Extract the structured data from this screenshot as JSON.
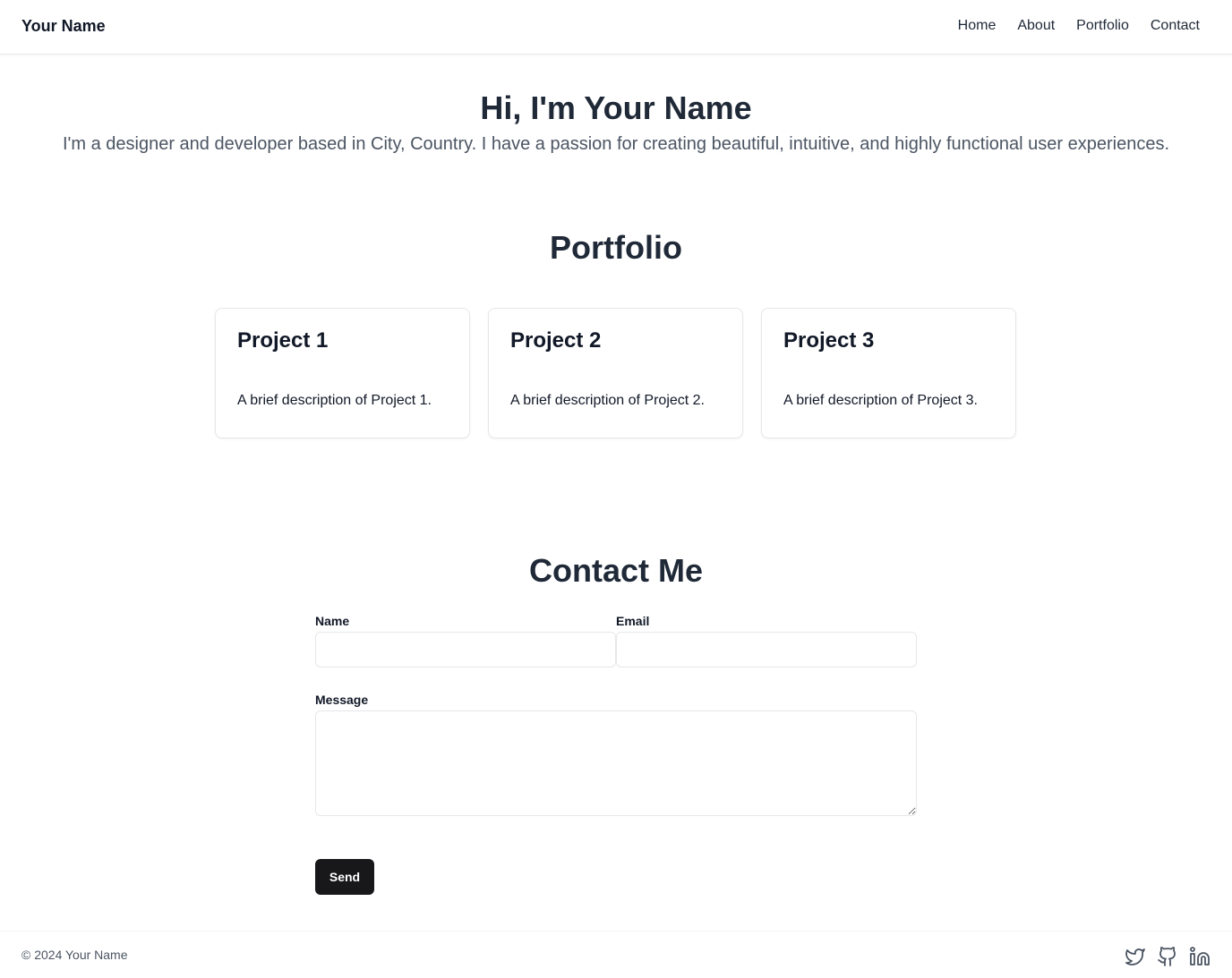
{
  "navbar": {
    "brand": "Your Name",
    "links": [
      "Home",
      "About",
      "Portfolio",
      "Contact"
    ]
  },
  "hero": {
    "title": "Hi, I'm Your Name",
    "subtitle": "I'm a designer and developer based in City, Country. I have a passion for creating beautiful, intuitive, and highly functional user experiences."
  },
  "portfolio": {
    "title": "Portfolio",
    "projects": [
      {
        "title": "Project 1",
        "description": "A brief description of Project 1."
      },
      {
        "title": "Project 2",
        "description": "A brief description of Project 2."
      },
      {
        "title": "Project 3",
        "description": "A brief description of Project 3."
      }
    ]
  },
  "contact": {
    "title": "Contact Me",
    "name_label": "Name",
    "name_value": "",
    "email_label": "Email",
    "email_value": "",
    "message_label": "Message",
    "message_value": "",
    "send_label": "Send"
  },
  "footer": {
    "copyright": "© 2024 Your Name",
    "social_icons": [
      "twitter-icon",
      "github-icon",
      "linkedin-icon"
    ]
  },
  "colors": {
    "heading": "#1f2937",
    "muted": "#4b5563",
    "button": "#18181b",
    "border": "#e5e7eb"
  }
}
